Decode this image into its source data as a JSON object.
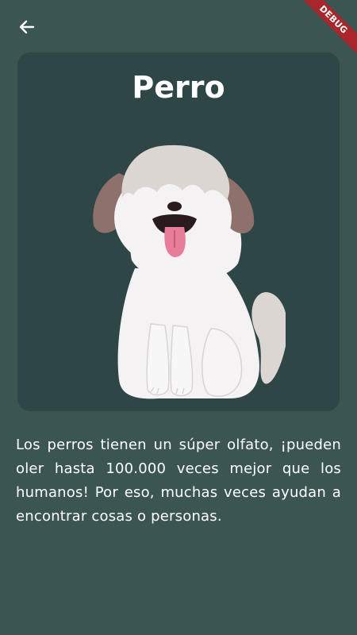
{
  "header": {
    "back_icon": "arrow-left-icon",
    "debug_label": "DEBUG"
  },
  "card": {
    "title": "Perro",
    "image_icon": "dog-illustration"
  },
  "description": "Los perros tienen un súper olfato, ¡pueden oler hasta 100.000 veces mejor que los humanos! Por eso, muchas veces ayudan a encontrar cosas o personas.",
  "colors": {
    "background": "#3b5553",
    "card": "#2f4647",
    "text": "#ffffff",
    "debug_ribbon": "#a8262c"
  }
}
